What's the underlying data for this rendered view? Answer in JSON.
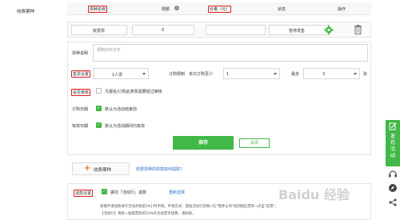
{
  "section_label": "收费票种",
  "table_header": {
    "col_name": "票种名称",
    "col_limit": "限额",
    "col_price": "价格（元）",
    "col_status": "状态",
    "col_action": "操作"
  },
  "ticket_row": {
    "name": "收费票",
    "quantity": "0",
    "status": "暂停发售"
  },
  "form": {
    "desc_label": "票种说明",
    "desc_placeholder": "限制200汉字",
    "visible_label": "售票设置",
    "visible_value": "1人票",
    "order_limit_label": "订购限制",
    "min_label": "单次订购至少",
    "min_value": "1",
    "max_label": "最多",
    "max_value": "3",
    "max_unit": "张",
    "review_label": "是否审核",
    "review_text": "凡报名/订购此类票需要经过审核",
    "order_date_label": "订购日期",
    "order_date_text": "默认为活动结束前",
    "valid_date_label": "有效日期",
    "valid_date_text": "默认为活动期间内有效",
    "save_label": "保存",
    "close_label": "关闭"
  },
  "add_ticket": {
    "label": "收费票种",
    "link": "收费票种的票款如何提取?"
  },
  "refund": {
    "label": "退款设置",
    "checkbox_text": "委托「活动行」退款",
    "reselect": "重新选择",
    "note_line1": "如需申请退款请于活动开始前24小时申请。申请方式：登陆活动行官网→在\"我参与的\"找到相应票务→点击\"退票\"，",
    "note_line2": "【活动行】将统一收取票款的10%作为退票手续费，请知悉。"
  },
  "right_rail": {
    "publish_label": "发布活动"
  },
  "watermark": "Baidu 经验",
  "colors": {
    "accent_green": "#41b847",
    "highlight_red": "#e01e1e",
    "orange": "#f26522"
  }
}
